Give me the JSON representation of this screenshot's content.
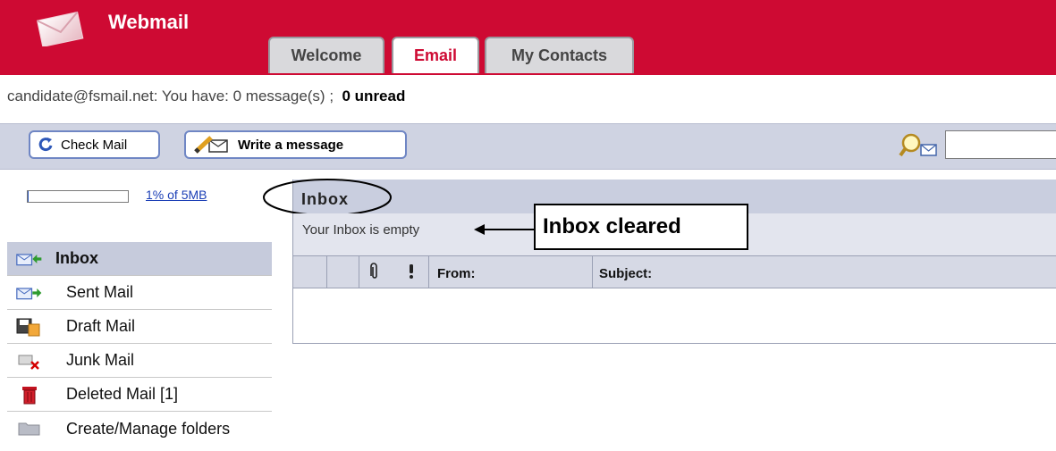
{
  "app": {
    "title": "Webmail",
    "brand_color": "#ce0a33",
    "logo_icon": "envelope-icon"
  },
  "tabs": [
    {
      "label": "Welcome",
      "active": false
    },
    {
      "label": "Email",
      "active": true
    },
    {
      "label": "My Contacts",
      "active": false
    }
  ],
  "status": {
    "email": "candidate@fsmail.net",
    "separator": ":",
    "summary": "You have: 0 message(s) ;",
    "unread": "0 unread"
  },
  "toolbar": {
    "check_mail_label": "Check Mail",
    "check_mail_icon": "refresh-icon",
    "write_message_label": "Write a message",
    "write_message_icon": "compose-icon",
    "search_icon": "search-icon",
    "search_value": ""
  },
  "quota": {
    "used_fraction": 0.01,
    "label": "1% of 5MB"
  },
  "folders": [
    {
      "label": "Inbox",
      "icon": "inbox-icon",
      "active": true
    },
    {
      "label": "Sent Mail",
      "icon": "sent-icon",
      "active": false
    },
    {
      "label": "Draft Mail",
      "icon": "draft-icon",
      "active": false
    },
    {
      "label": "Junk Mail",
      "icon": "junk-icon",
      "active": false
    },
    {
      "label": "Deleted Mail [1]",
      "icon": "trash-icon",
      "active": false
    },
    {
      "label": "Create/Manage folders",
      "icon": "folder-icon",
      "active": false
    }
  ],
  "mailbox": {
    "title": "Inbox",
    "empty_message": "Your Inbox is empty",
    "columns": {
      "attachment_icon": "paperclip-icon",
      "priority_icon": "exclamation-icon",
      "from": "From:",
      "subject": "Subject:"
    }
  },
  "annotation": {
    "callout_text": "Inbox cleared"
  }
}
